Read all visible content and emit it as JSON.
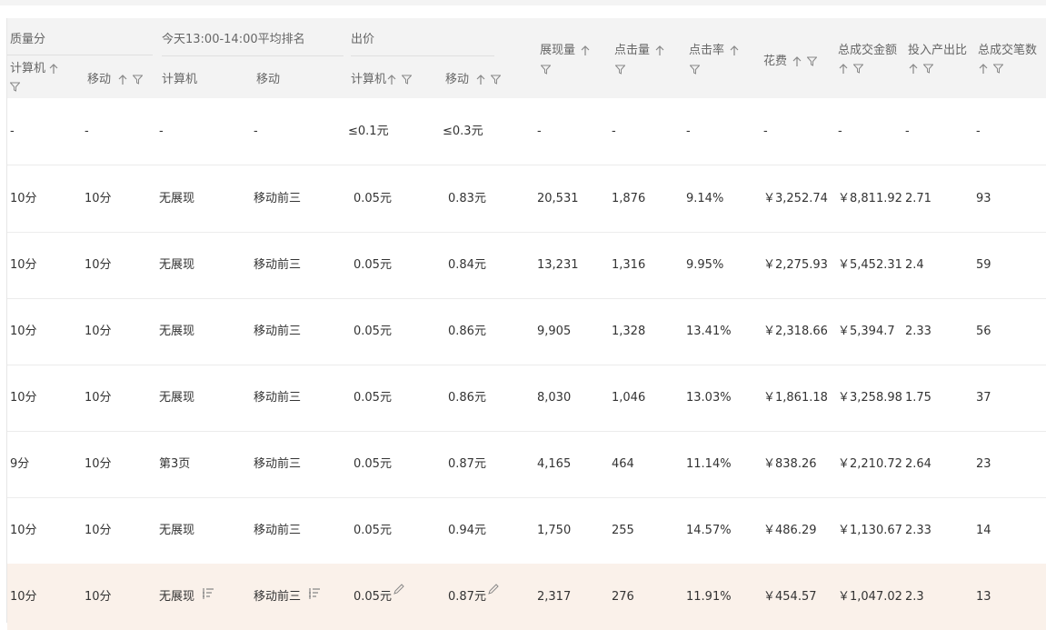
{
  "header": {
    "group_quality": "质量分",
    "group_rank": "今天13:00-14:00平均排名",
    "group_bid": "出价",
    "col_pc_quality": "计算机",
    "col_mobile_quality": "移动",
    "col_pc_rank": "计算机",
    "col_mobile_rank": "移动",
    "col_pc_bid": "计算机",
    "col_mobile_bid": "移动",
    "col_impressions": "展现量",
    "col_clicks": "点击量",
    "col_ctr": "点击率",
    "col_cost": "花费",
    "col_gmv": "总成交金额",
    "col_roi": "投入产出比",
    "col_orders": "总成交笔数"
  },
  "rows": [
    {
      "q_pc": "-",
      "q_m": "-",
      "r_pc": "-",
      "r_m": "-",
      "b_pc": "≤0.1元",
      "b_m": "≤0.3元",
      "imp": "-",
      "clk": "-",
      "ctr": "-",
      "cost": "-",
      "gmv": "-",
      "roi": "-",
      "orders": "-"
    },
    {
      "q_pc": "10分",
      "q_m": "10分",
      "r_pc": "无展现",
      "r_m": "移动前三",
      "b_pc": "0.05元",
      "b_m": "0.83元",
      "imp": "20,531",
      "clk": "1,876",
      "ctr": "9.14%",
      "cost": "￥3,252.74",
      "gmv": "￥8,811.92",
      "roi": "2.71",
      "orders": "93"
    },
    {
      "q_pc": "10分",
      "q_m": "10分",
      "r_pc": "无展现",
      "r_m": "移动前三",
      "b_pc": "0.05元",
      "b_m": "0.84元",
      "imp": "13,231",
      "clk": "1,316",
      "ctr": "9.95%",
      "cost": "￥2,275.93",
      "gmv": "￥5,452.31",
      "roi": "2.4",
      "orders": "59"
    },
    {
      "q_pc": "10分",
      "q_m": "10分",
      "r_pc": "无展现",
      "r_m": "移动前三",
      "b_pc": "0.05元",
      "b_m": "0.86元",
      "imp": "9,905",
      "clk": "1,328",
      "ctr": "13.41%",
      "cost": "￥2,318.66",
      "gmv": "￥5,394.7",
      "roi": "2.33",
      "orders": "56"
    },
    {
      "q_pc": "10分",
      "q_m": "10分",
      "r_pc": "无展现",
      "r_m": "移动前三",
      "b_pc": "0.05元",
      "b_m": "0.86元",
      "imp": "8,030",
      "clk": "1,046",
      "ctr": "13.03%",
      "cost": "￥1,861.18",
      "gmv": "￥3,258.98",
      "roi": "1.75",
      "orders": "37"
    },
    {
      "q_pc": "9分",
      "q_m": "10分",
      "r_pc": "第3页",
      "r_m": "移动前三",
      "b_pc": "0.05元",
      "b_m": "0.87元",
      "imp": "4,165",
      "clk": "464",
      "ctr": "11.14%",
      "cost": "￥838.26",
      "gmv": "￥2,210.72",
      "roi": "2.64",
      "orders": "23"
    },
    {
      "q_pc": "10分",
      "q_m": "10分",
      "r_pc": "无展现",
      "r_m": "移动前三",
      "b_pc": "0.05元",
      "b_m": "0.94元",
      "imp": "1,750",
      "clk": "255",
      "ctr": "14.57%",
      "cost": "￥486.29",
      "gmv": "￥1,130.67",
      "roi": "2.33",
      "orders": "14"
    },
    {
      "q_pc": "10分",
      "q_m": "10分",
      "r_pc": "无展现",
      "r_m": "移动前三",
      "b_pc": "0.05元",
      "b_m": "0.87元",
      "imp": "2,317",
      "clk": "276",
      "ctr": "11.91%",
      "cost": "￥454.57",
      "gmv": "￥1,047.02",
      "roi": "2.3",
      "orders": "13"
    }
  ],
  "colors": {
    "header_bg": "#f3f3f3",
    "highlight_row": "#faf1ea",
    "border": "#ececec"
  }
}
